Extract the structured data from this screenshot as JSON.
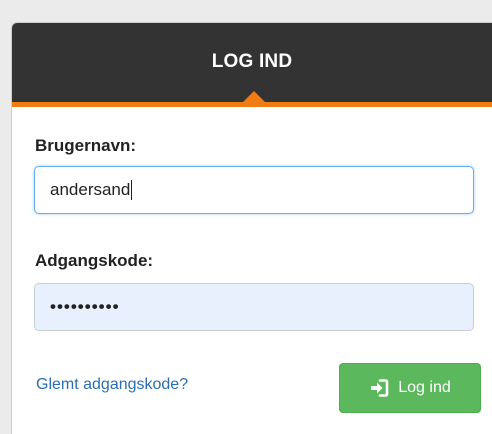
{
  "header": {
    "title": "LOG IND"
  },
  "form": {
    "username_label": "Brugernavn:",
    "username_value": "andersand",
    "password_label": "Adgangskode:",
    "password_value": "••••••••••",
    "forgot_link": "Glemt adgangskode?",
    "login_button": "Log ind"
  },
  "colors": {
    "header_bg": "#333333",
    "accent": "#f07c14",
    "button": "#5cb85c",
    "link": "#2a6fb0",
    "autofill_bg": "#e8f0fe"
  },
  "icons": {
    "login_icon": "sign-in-icon"
  }
}
